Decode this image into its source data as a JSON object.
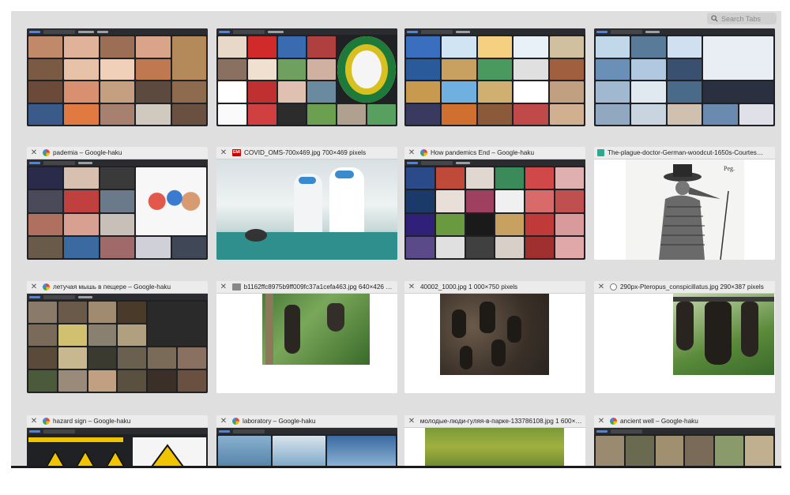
{
  "search": {
    "placeholder": "Search Tabs",
    "icon": "search-icon"
  },
  "tabs_row1": [
    {
      "title": "",
      "has_header": false
    },
    {
      "title": "",
      "has_header": false
    },
    {
      "title": "",
      "has_header": false
    },
    {
      "title": "",
      "has_header": false
    }
  ],
  "tabs_row2": [
    {
      "title": "pademia – Google-haku",
      "favicon": "google-icon"
    },
    {
      "title": "COVID_OMS-700x469.jpg 700×469 pixels",
      "favicon": "image-file-icon"
    },
    {
      "title": "How pandemics End – Google-haku",
      "favicon": "google-icon"
    },
    {
      "title": "The-plague-doctor-German-woodcut-1650s-Courtes…",
      "favicon": "figure-icon"
    }
  ],
  "tabs_row3": [
    {
      "title": "летучая мышь в пещере – Google-haku",
      "favicon": "google-icon"
    },
    {
      "title": "b1162ffc8975b9ff009fc37a1cefa463.jpg 640×426 pix…",
      "favicon": "image-file-icon"
    },
    {
      "title": "40002_1000.jpg 1 000×750 pixels",
      "favicon": "none"
    },
    {
      "title": "290px-Pteropus_conspicillatus.jpg 290×387 pixels",
      "favicon": "wikipedia-icon"
    }
  ],
  "tabs_row4": [
    {
      "title": "hazard sign – Google-haku",
      "favicon": "google-icon"
    },
    {
      "title": "laboratory – Google-haku",
      "favicon": "google-icon"
    },
    {
      "title": "молодые-люди-гуляя-в-парке-133786108.jpg 1 600×1…",
      "favicon": "none"
    },
    {
      "title": "ancient well – Google-haku",
      "favicon": "google-icon"
    }
  ],
  "colors": {
    "window_bg": "#dfdfdf",
    "header_bg": "#ececec",
    "google_dark": "#202124"
  }
}
